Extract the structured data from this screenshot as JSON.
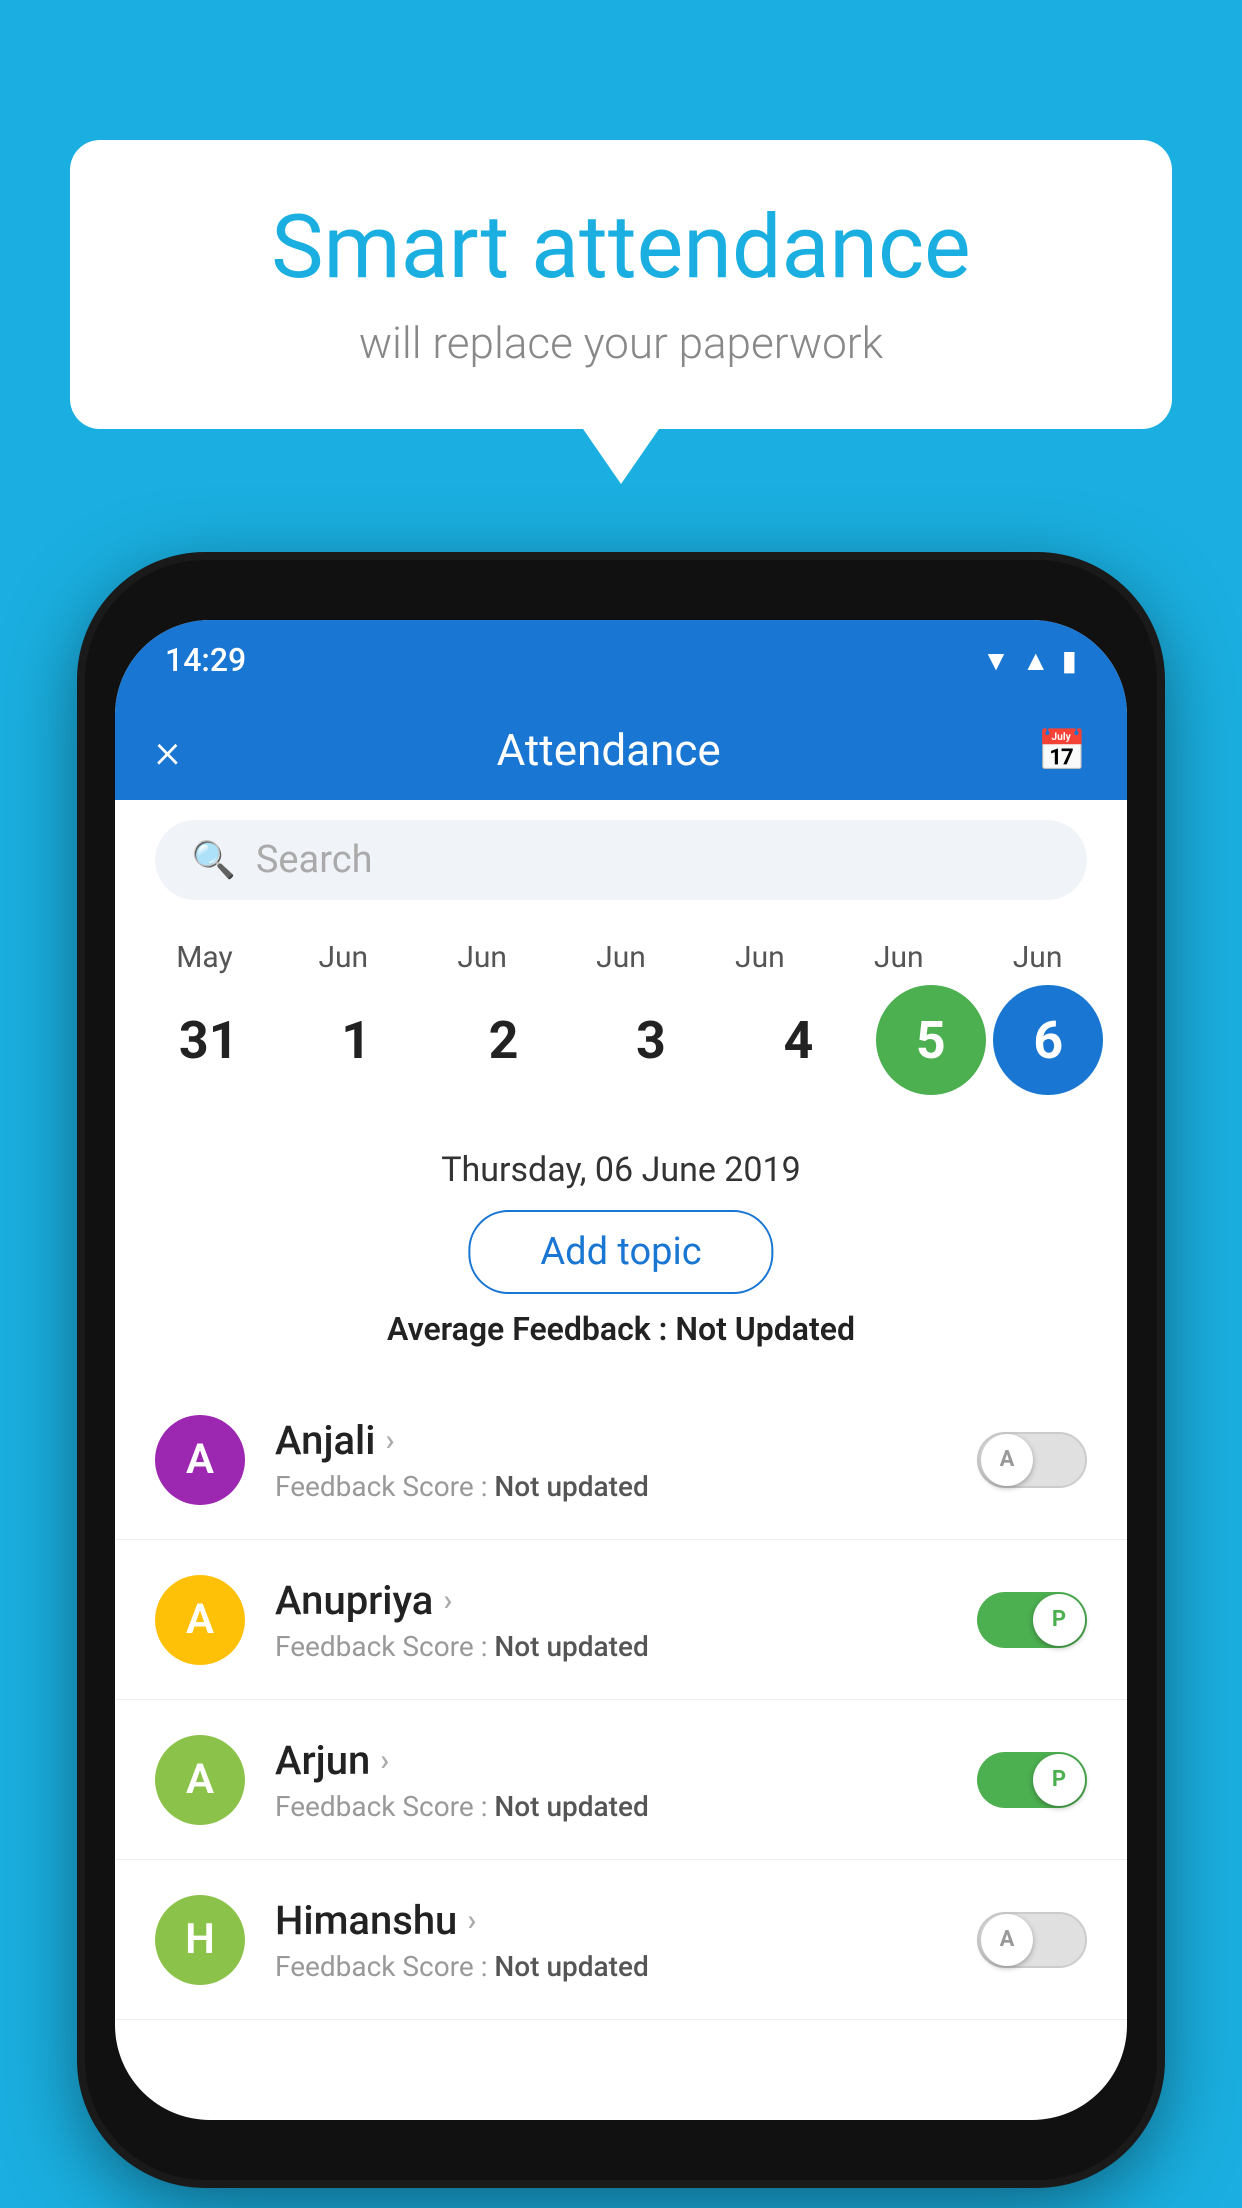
{
  "background": {
    "color": "#1AAFE0"
  },
  "bubble": {
    "title": "Smart attendance",
    "subtitle": "will replace your paperwork"
  },
  "phone": {
    "statusBar": {
      "time": "14:29"
    },
    "appBar": {
      "title": "Attendance",
      "closeLabel": "×"
    },
    "search": {
      "placeholder": "Search"
    },
    "calendar": {
      "months": [
        "May",
        "Jun",
        "Jun",
        "Jun",
        "Jun",
        "Jun",
        "Jun"
      ],
      "days": [
        "31",
        "1",
        "2",
        "3",
        "4",
        "5",
        "6"
      ],
      "todayIndex": 5,
      "selectedIndex": 6
    },
    "selectedDate": "Thursday, 06 June 2019",
    "addTopicLabel": "Add topic",
    "avgFeedback": {
      "label": "Average Feedback : ",
      "value": "Not Updated"
    },
    "students": [
      {
        "name": "Anjali",
        "initial": "A",
        "avatarColor": "#9C27B0",
        "feedbackLabel": "Feedback Score : ",
        "feedbackValue": "Not updated",
        "toggleState": "off",
        "toggleLabel": "A"
      },
      {
        "name": "Anupriya",
        "initial": "A",
        "avatarColor": "#FFC107",
        "feedbackLabel": "Feedback Score : ",
        "feedbackValue": "Not updated",
        "toggleState": "on",
        "toggleLabel": "P"
      },
      {
        "name": "Arjun",
        "initial": "A",
        "avatarColor": "#8BC34A",
        "feedbackLabel": "Feedback Score : ",
        "feedbackValue": "Not updated",
        "toggleState": "on",
        "toggleLabel": "P"
      },
      {
        "name": "Himanshu",
        "initial": "H",
        "avatarColor": "#8BC34A",
        "feedbackLabel": "Feedback Score : ",
        "feedbackValue": "Not updated",
        "toggleState": "off",
        "toggleLabel": "A"
      }
    ]
  }
}
